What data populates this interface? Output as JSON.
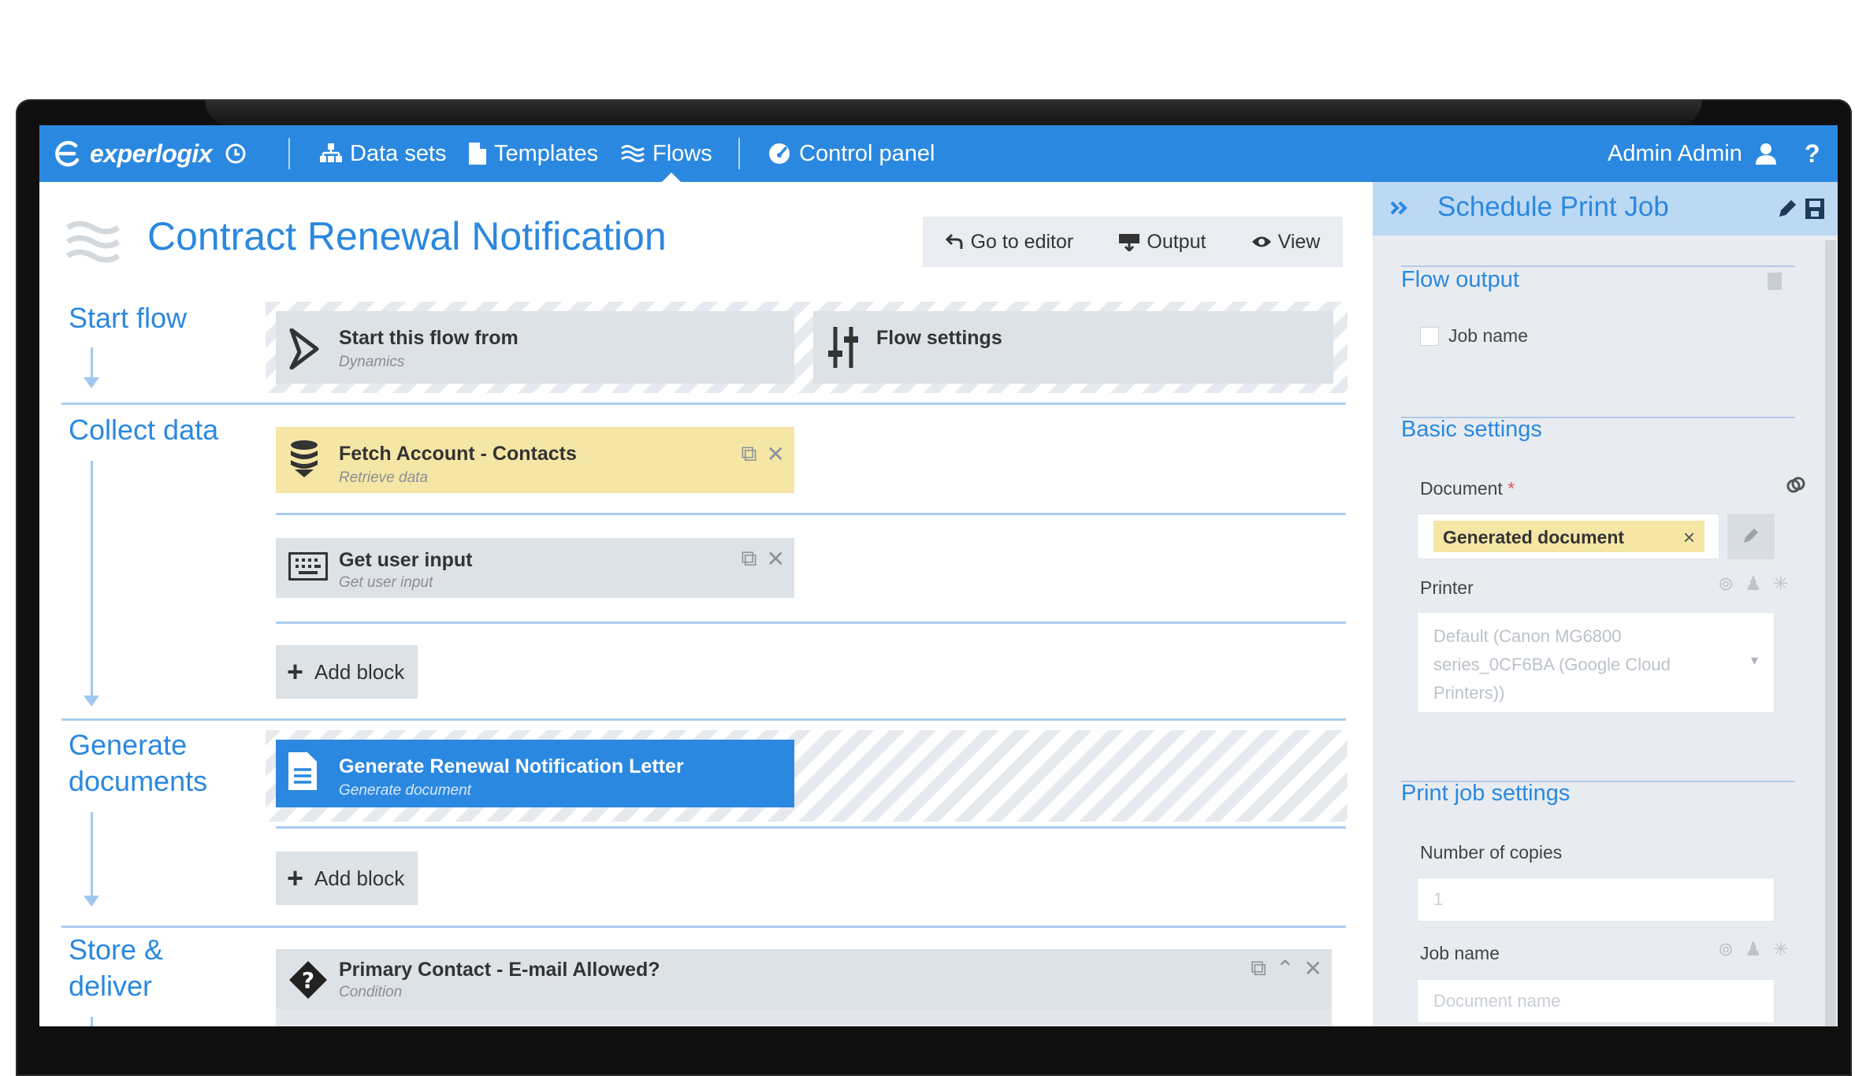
{
  "topbar": {
    "logo": "experlogix",
    "nav": [
      {
        "label": "Data sets",
        "icon": "sitemap-icon"
      },
      {
        "label": "Templates",
        "icon": "file-icon"
      },
      {
        "label": "Flows",
        "icon": "flows-icon",
        "active": true
      },
      {
        "label": "Control panel",
        "icon": "gauge-icon"
      }
    ],
    "user": "Admin Admin",
    "help": "?"
  },
  "page": {
    "title": "Contract Renewal Notification",
    "toolbar": {
      "go_to_editor": "Go to editor",
      "output": "Output",
      "view": "View"
    }
  },
  "sections": [
    {
      "label": "Start flow"
    },
    {
      "label": "Collect data"
    },
    {
      "label_line1": "Generate",
      "label_line2": "documents"
    },
    {
      "label_line1": "Store &",
      "label_line2": "deliver"
    }
  ],
  "blocks": {
    "start_from": {
      "title": "Start this flow from",
      "subtitle": "Dynamics"
    },
    "flow_settings": {
      "title": "Flow settings"
    },
    "fetch": {
      "title": "Fetch Account - Contacts",
      "subtitle": "Retrieve data"
    },
    "user_input": {
      "title": "Get user input",
      "subtitle": "Get user input"
    },
    "add_block_1": "Add block",
    "generate": {
      "title": "Generate Renewal Notification Letter",
      "subtitle": "Generate document"
    },
    "add_block_2": "Add block",
    "condition": {
      "title": "Primary Contact - E-mail Allowed?",
      "subtitle": "Condition"
    }
  },
  "panel": {
    "title": "Schedule Print Job",
    "flow_output": {
      "heading": "Flow output",
      "job_name_checkbox": "Job name"
    },
    "basic": {
      "heading": "Basic settings",
      "document_label": "Document",
      "required_mark": "*",
      "document_value": "Generated document",
      "clear": "×",
      "printer_label": "Printer",
      "printer_line1": "Default (Canon MG6800",
      "printer_line2": "series_0CF6BA (Google Cloud",
      "printer_line3": "Printers))"
    },
    "print_job": {
      "heading": "Print job settings",
      "copies_label": "Number of copies",
      "copies_placeholder": "1",
      "job_name_label": "Job name",
      "job_name_placeholder": "Document name"
    }
  },
  "colors": {
    "accent": "#2b88e0",
    "block_gray": "#dde2e7",
    "block_yellow": "#f5e6a6",
    "panel_bg": "#e8ecf0"
  }
}
